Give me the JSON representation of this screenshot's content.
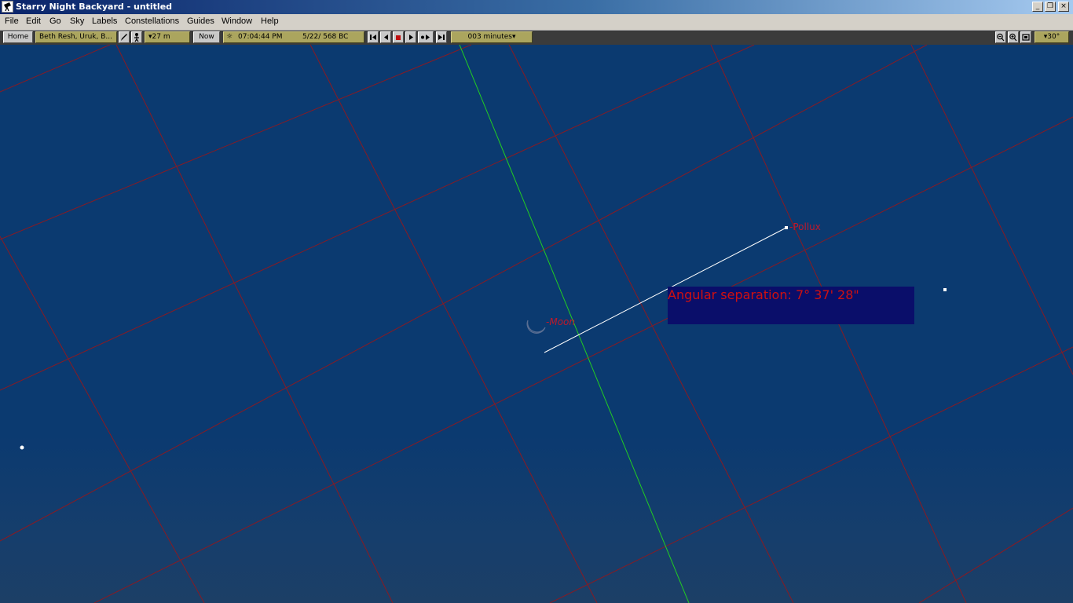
{
  "window": {
    "title": "Starry Night Backyard - untitled"
  },
  "window_controls": {
    "minimize": "_",
    "restore": "❐",
    "close": "×"
  },
  "menu": [
    "File",
    "Edit",
    "Go",
    "Sky",
    "Labels",
    "Constellations",
    "Guides",
    "Window",
    "Help"
  ],
  "toolbar": {
    "home_label": "Home",
    "location": "Beth Resh, Uruk, B...",
    "elevation": "▾27 m",
    "now_label": "Now",
    "time": "07:04:44 PM",
    "date": "5/22/  568 BC",
    "time_step": "003 minutes▾",
    "field_of_view": "▾30°"
  },
  "sky": {
    "labels": {
      "pollux": "Pollux",
      "moon": "Moon"
    },
    "angular_separation": "Angular separation: 7° 37' 28\""
  },
  "colors": {
    "sky": "#0b3a70",
    "grid": "#8a1a22",
    "meridian": "#22cc22",
    "label": "#c0182a",
    "measure_line": "#ffffff"
  }
}
